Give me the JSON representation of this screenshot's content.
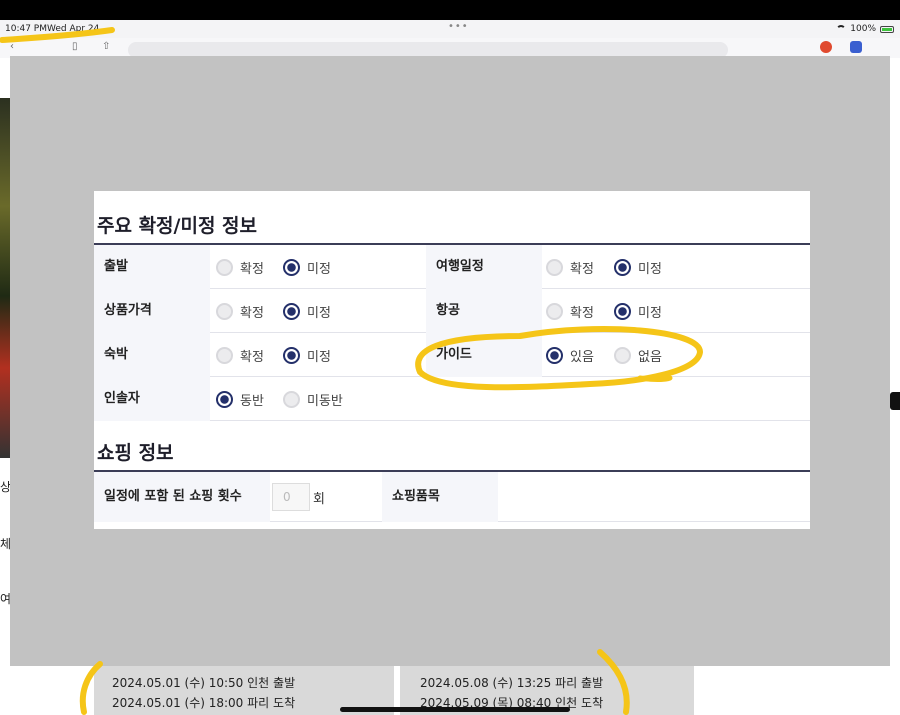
{
  "status_bar": {
    "time": "10:47 PM",
    "date": "Wed Apr 24",
    "battery": "100%"
  },
  "section1": {
    "title": "주요 확정/미정 정보",
    "rows": [
      {
        "label": "출발",
        "options": [
          "확정",
          "미정"
        ],
        "selected": 1
      },
      {
        "label": "여행일정",
        "options": [
          "확정",
          "미정"
        ],
        "selected": 1
      },
      {
        "label": "상품가격",
        "options": [
          "확정",
          "미정"
        ],
        "selected": 1
      },
      {
        "label": "항공",
        "options": [
          "확정",
          "미정"
        ],
        "selected": 1
      },
      {
        "label": "숙박",
        "options": [
          "확정",
          "미정"
        ],
        "selected": 1
      },
      {
        "label": "가이드",
        "options": [
          "있음",
          "없음"
        ],
        "selected": 0
      },
      {
        "label": "인솔자",
        "options": [
          "동반",
          "미동반"
        ],
        "selected": 0
      }
    ]
  },
  "section2": {
    "title": "쇼핑 정보",
    "count_label": "일정에 포함 된 쇼핑 횟수",
    "count_value": "0",
    "count_unit": "회",
    "items_label": "쇼핑품목"
  },
  "flights": {
    "outbound": [
      "2024.05.01 (수) 10:50 인천 출발",
      "2024.05.01 (수) 18:00 파리 도착"
    ],
    "inbound": [
      "2024.05.08 (수) 13:25 파리 출발",
      "2024.05.09 (목) 08:40 인천 도착"
    ]
  },
  "colors": {
    "accent": "#24306a",
    "annotation": "#f5c518",
    "overlay": "#c2c2c2"
  }
}
